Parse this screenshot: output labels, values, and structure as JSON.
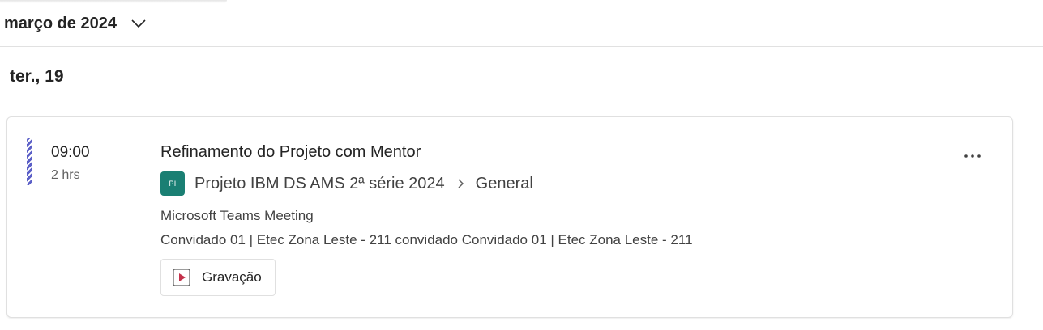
{
  "header": {
    "month_label": "março de 2024"
  },
  "day": {
    "label": "ter., 19"
  },
  "event": {
    "time": "09:00",
    "duration": "2 hrs",
    "title": "Refinamento do Projeto com Mentor",
    "team_avatar_initials": "PI",
    "team_name": "Projeto IBM DS AMS 2ª série 2024",
    "channel_name": "General",
    "meeting_type": "Microsoft Teams Meeting",
    "attendees": "Convidado 01 | Etec Zona Leste - 211 convidado Convidado 01 | Etec Zona Leste - 211",
    "recording_label": "Gravação"
  },
  "icons": {
    "month_dropdown": "chevron-down-icon",
    "breadcrumb_separator": "chevron-right-icon",
    "recording": "play-icon",
    "more": "more-options-icon"
  },
  "colors": {
    "event_stripe": "#5b5fc7",
    "team_avatar_bg": "#1a7f73",
    "play_icon": "#c4314b"
  }
}
